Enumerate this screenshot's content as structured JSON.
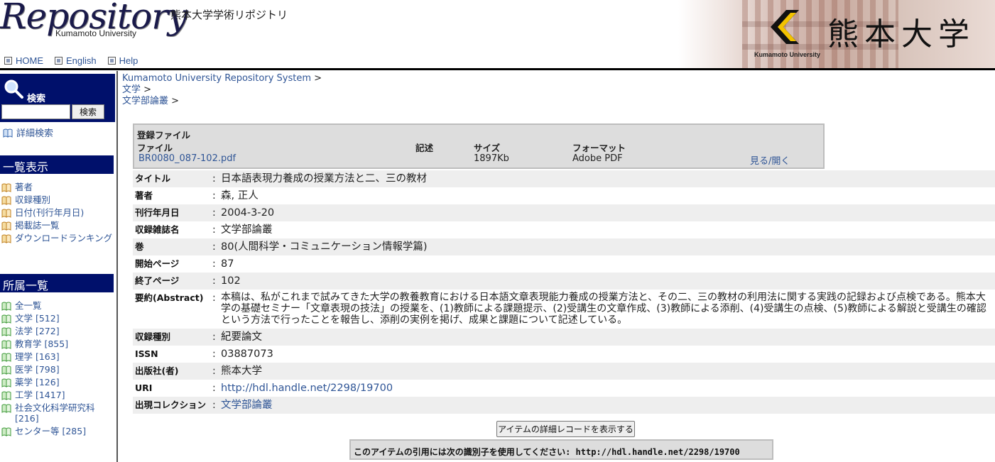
{
  "header": {
    "logo_text": "Repository",
    "logo_sub": "Kumamoto University",
    "logo_jp": "熊本大学学術リポジトリ",
    "banner_small": "Kumamoto University",
    "banner_big": "熊本大学",
    "nav": [
      {
        "label": "HOME"
      },
      {
        "label": "English"
      },
      {
        "label": "Help"
      }
    ]
  },
  "sidebar": {
    "search_label": "検索",
    "search_value": "",
    "search_button": "検索",
    "advanced_search": "詳細検索",
    "browse_heading": "一覧表示",
    "browse_items": [
      {
        "label": "著者"
      },
      {
        "label": "収録種別"
      },
      {
        "label": "日付(刊行年月日)"
      },
      {
        "label": "掲載誌一覧"
      },
      {
        "label": "ダウンロードランキング"
      }
    ],
    "affil_heading": "所属一覧",
    "affil_items": [
      {
        "label": "全一覧"
      },
      {
        "label": "文学 [512]"
      },
      {
        "label": "法学 [272]"
      },
      {
        "label": "教育学 [855]"
      },
      {
        "label": "理学 [163]"
      },
      {
        "label": "医学 [798]"
      },
      {
        "label": "薬学 [126]"
      },
      {
        "label": "工学 [1417]"
      },
      {
        "label": "社会文化科学研究科 [216]"
      },
      {
        "label": "センター等 [285]"
      }
    ]
  },
  "breadcrumb": {
    "items": [
      {
        "label": "Kumamoto University Repository System",
        "sep": " >"
      },
      {
        "label": "文学",
        "sep": " >"
      },
      {
        "label": "文学部論叢",
        "sep": " >"
      }
    ]
  },
  "files": {
    "title": "登録ファイル",
    "headers": {
      "file": "ファイル",
      "desc": "記述",
      "size": "サイズ",
      "format": "フォーマット"
    },
    "row": {
      "file": "BR0080_087-102.pdf",
      "desc": "",
      "size": "1897Kb",
      "format": "Adobe PDF",
      "action": "見る/開く"
    }
  },
  "metadata": [
    {
      "key": "タイトル",
      "colon": ":",
      "value": "日本語表現力養成の授業方法と二、三の教材"
    },
    {
      "key": "著者",
      "colon": ":",
      "value": "森, 正人"
    },
    {
      "key": "刊行年月日",
      "colon": ":",
      "value": "2004-3-20"
    },
    {
      "key": "収録雑誌名",
      "colon": ":",
      "value": "文学部論叢"
    },
    {
      "key": "巻",
      "colon": ":",
      "value": "80(人間科学・コミュニケーション情報学篇)"
    },
    {
      "key": "開始ページ",
      "colon": ":",
      "value": "87"
    },
    {
      "key": "終了ページ",
      "colon": ":",
      "value": "102"
    },
    {
      "key": "要約(Abstract)",
      "colon": ":",
      "value": "本稿は、私がこれまで試みてきた大学の教養教育における日本語文章表現能力養成の授業方法と、その二、三の教材の利用法に関する実践の記録および点検である。熊本大学の基礎セミナー「文章表現の技法」の授業を、(1)教師による課題提示、(2)受講生の文章作成、(3)教師による添削、(4)受講生の点検、(5)教師による解説と受講生の確認という方法で行ったことを報告し、添削の実例を掲げ、成果と課題について記述している。"
    },
    {
      "key": "収録種別",
      "colon": ":",
      "value": "紀要論文"
    },
    {
      "key": "ISSN",
      "colon": ":",
      "value": "03887073"
    },
    {
      "key": "出版社(者)",
      "colon": ":",
      "value": "熊本大学"
    },
    {
      "key": "URI",
      "colon": ":",
      "value": "http://hdl.handle.net/2298/19700"
    },
    {
      "key": "出現コレクション",
      "colon": ":",
      "value": "文学部論叢"
    }
  ],
  "detail_button": "アイテムの詳細レコードを表示する",
  "citation": "このアイテムの引用には次の識別子を使用してください: http://hdl.handle.net/2298/19700",
  "colors": {
    "accent": "#00106b",
    "link": "#2f5596",
    "stripe": "#eeeeee"
  },
  "icons": {
    "nav": "checkbox-square-icon",
    "list": "book-leaf-icon",
    "search": "magnifier-icon"
  }
}
